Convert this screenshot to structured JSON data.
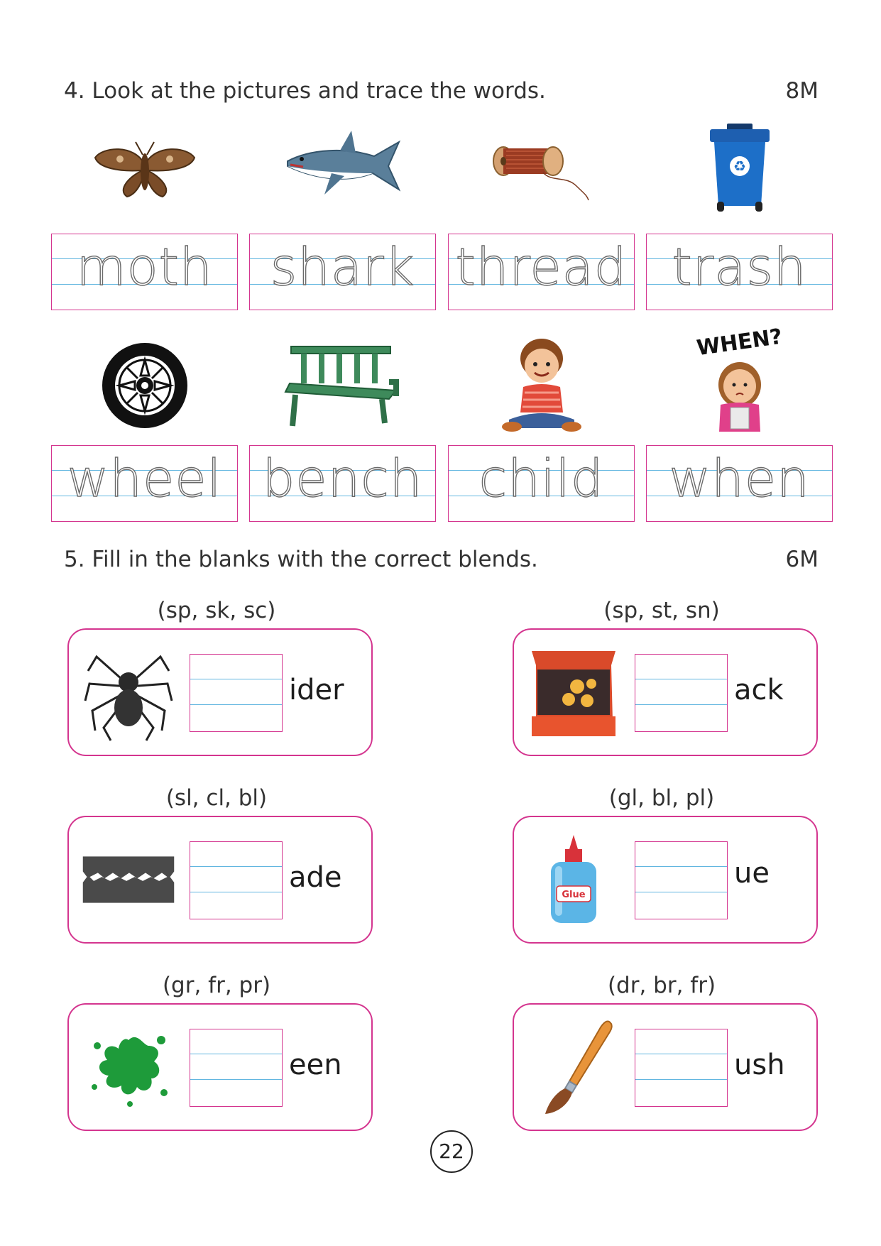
{
  "q4": {
    "title": "4. Look at the pictures and trace the words.",
    "marks": "8M",
    "words": [
      {
        "word": "moth",
        "icon": "moth-icon"
      },
      {
        "word": "shark",
        "icon": "shark-icon"
      },
      {
        "word": "thread",
        "icon": "thread-spool-icon"
      },
      {
        "word": "trash",
        "icon": "recycle-bin-icon"
      },
      {
        "word": "wheel",
        "icon": "wheel-icon"
      },
      {
        "word": "bench",
        "icon": "bench-icon"
      },
      {
        "word": "child",
        "icon": "child-icon"
      },
      {
        "word": "when",
        "icon": "girl-thinking-icon"
      }
    ],
    "when_caption": "WHEN?"
  },
  "q5": {
    "title": "5. Fill in the blanks with the correct blends.",
    "marks": "6M",
    "items": [
      {
        "hint": "(sp, sk, sc)",
        "ending": "ider",
        "icon": "spider-icon"
      },
      {
        "hint": "(sp, st, sn)",
        "ending": "ack",
        "icon": "snack-bag-icon"
      },
      {
        "hint": "(sl, cl, bl)",
        "ending": "ade",
        "icon": "razor-blade-icon"
      },
      {
        "hint": "(gl, bl, pl)",
        "ending": "ue",
        "icon": "glue-bottle-icon"
      },
      {
        "hint": "(gr, fr, pr)",
        "ending": "een",
        "icon": "green-splash-icon"
      },
      {
        "hint": "(dr, br, fr)",
        "ending": "ush",
        "icon": "paint-brush-icon"
      }
    ],
    "glue_label": "Glue"
  },
  "colors": {
    "border": "#d4358f",
    "guide_line": "#62b6e0"
  },
  "page_number": "22"
}
